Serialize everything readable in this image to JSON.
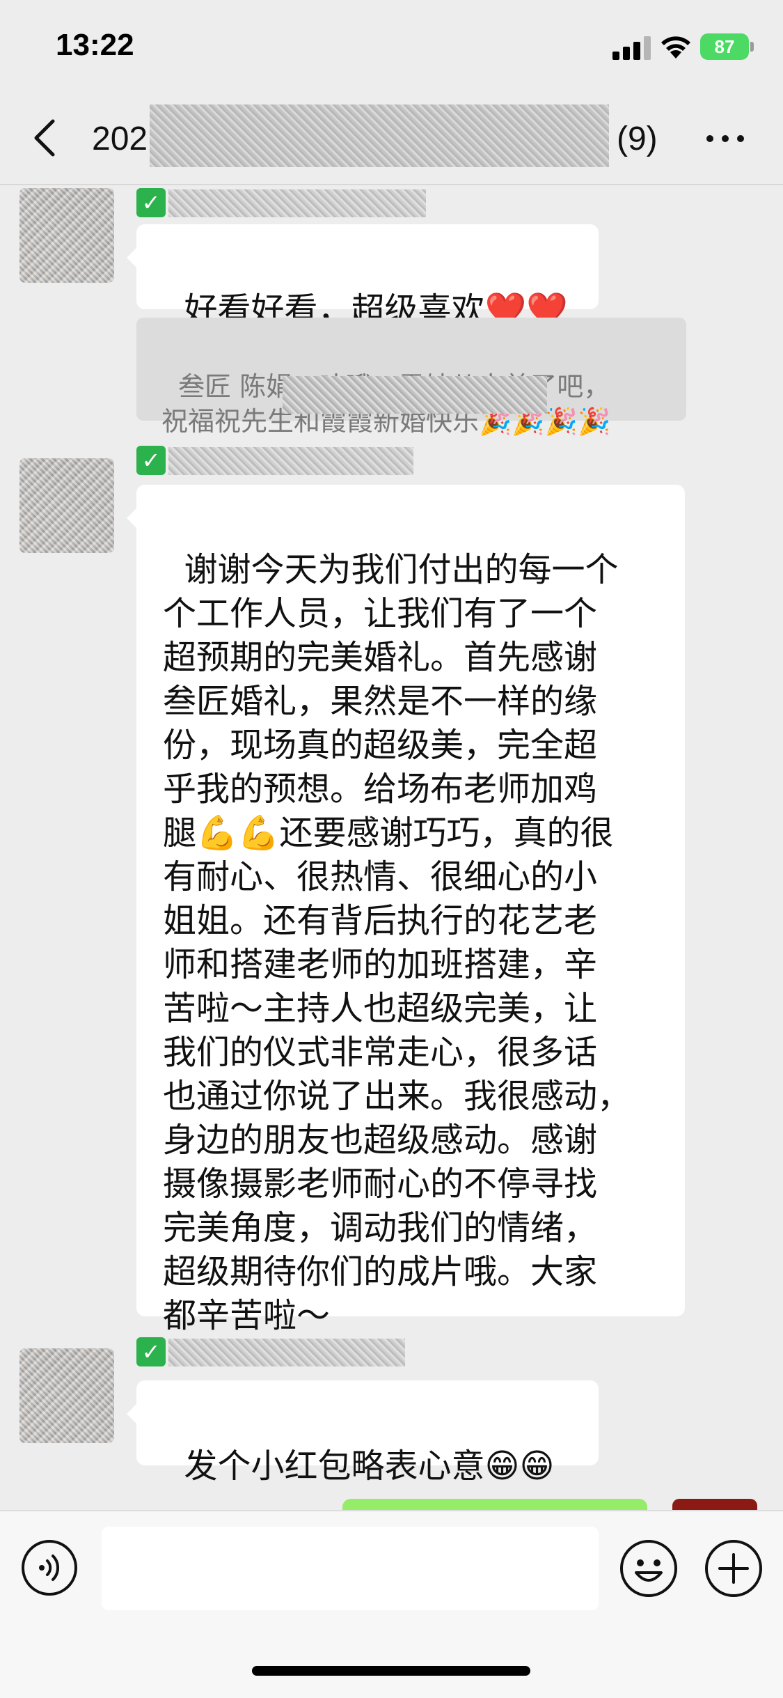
{
  "status_bar": {
    "time": "13:22",
    "battery": "87"
  },
  "nav": {
    "title_prefix": "202",
    "member_count": "(9)"
  },
  "messages": [
    {
      "text": "好看好看，超级喜欢❤️❤️"
    },
    {
      "text": "谢谢今天为我们付出的每一个\n个工作人员，让我们有了一个\n超预期的完美婚礼。首先感谢\n叁匠婚礼，果然是不一样的缘\n份，现场真的超级美，完全超\n乎我的预想。给场布老师加鸡\n腿💪💪还要感谢巧巧，真的很\n有耐心、很热情、很细心的小\n姐姐。还有背后执行的花艺老\n师和搭建老师的加班搭建，辛\n苦啦～主持人也超级完美，让\n我们的仪式非常走心，很多话\n也通过你说了出来。我很感动，\n身边的朋友也超级感动。感谢\n摄像摄影老师耐心的不停寻找\n完美角度，调动我们的情绪，\n超级期待你们的成片哦。大家\n都辛苦啦～"
    },
    {
      "text": "发个小红包略表心意😁😁"
    }
  ],
  "quote": {
    "text": "叁匠 陈娟：哇哦，霞妹儿太美了吧，\n祝福祝先生和霞霞新婚快乐🎉🎉🎉🎉"
  },
  "input": {
    "value": ""
  },
  "icons": {
    "back": "chevron-left-icon",
    "more": "more-dots-icon",
    "voice": "voice-icon",
    "emoji": "emoji-icon",
    "plus": "plus-icon"
  },
  "colors": {
    "background": "#ededed",
    "bubble": "#ffffff",
    "sent_bubble": "#95ec69",
    "battery": "#4cd964",
    "check_badge": "#2bb24c"
  }
}
